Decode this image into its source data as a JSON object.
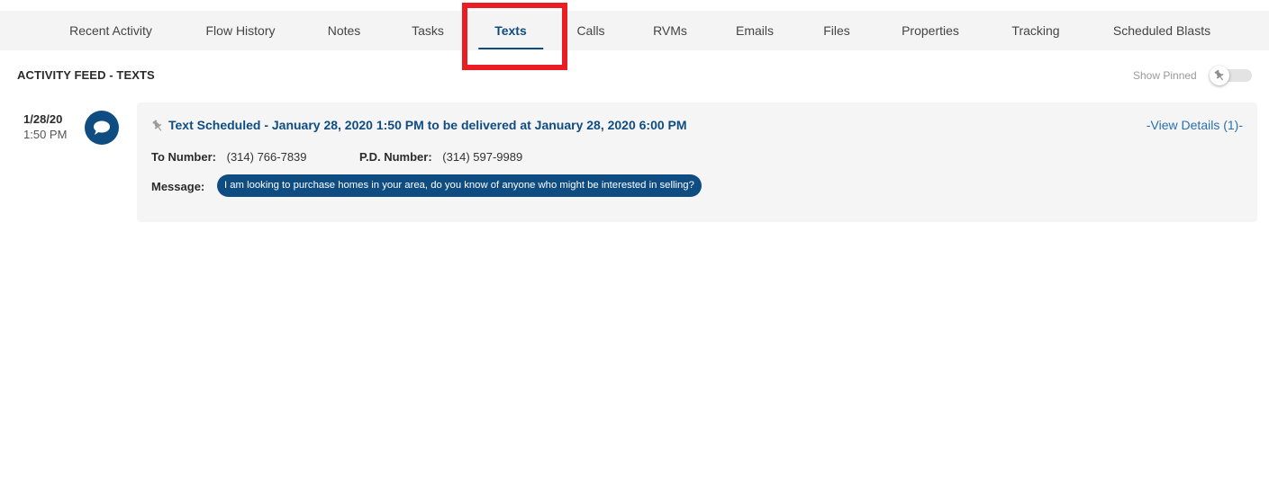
{
  "tabs": [
    {
      "label": "Recent Activity",
      "active": false
    },
    {
      "label": "Flow History",
      "active": false
    },
    {
      "label": "Notes",
      "active": false
    },
    {
      "label": "Tasks",
      "active": false
    },
    {
      "label": "Texts",
      "active": true
    },
    {
      "label": "Calls",
      "active": false
    },
    {
      "label": "RVMs",
      "active": false
    },
    {
      "label": "Emails",
      "active": false
    },
    {
      "label": "Files",
      "active": false
    },
    {
      "label": "Properties",
      "active": false
    },
    {
      "label": "Tracking",
      "active": false
    },
    {
      "label": "Scheduled Blasts",
      "active": false
    }
  ],
  "feed": {
    "title": "ACTIVITY FEED - TEXTS",
    "show_pinned_label": "Show Pinned",
    "show_pinned_on": false
  },
  "entry": {
    "date": "1/28/20",
    "time": "1:50 PM",
    "icon": "chat-bubble-icon",
    "title": "Text Scheduled - January 28, 2020 1:50 PM to be delivered at January 28, 2020 6:00 PM",
    "view_details": "-View Details (1)-",
    "to_number_label": "To Number:",
    "to_number": "(314) 766-7839",
    "pd_number_label": "P.D. Number:",
    "pd_number": "(314) 597-9989",
    "message_label": "Message:",
    "message": "I am looking to purchase homes in your area, do you know of anyone who might be interested in selling?"
  },
  "colors": {
    "primary": "#0f4c81",
    "highlight": "#ea1c24",
    "link": "#2a6fad",
    "card_bg": "#f5f5f5",
    "tabbar_bg": "#f4f4f4"
  }
}
